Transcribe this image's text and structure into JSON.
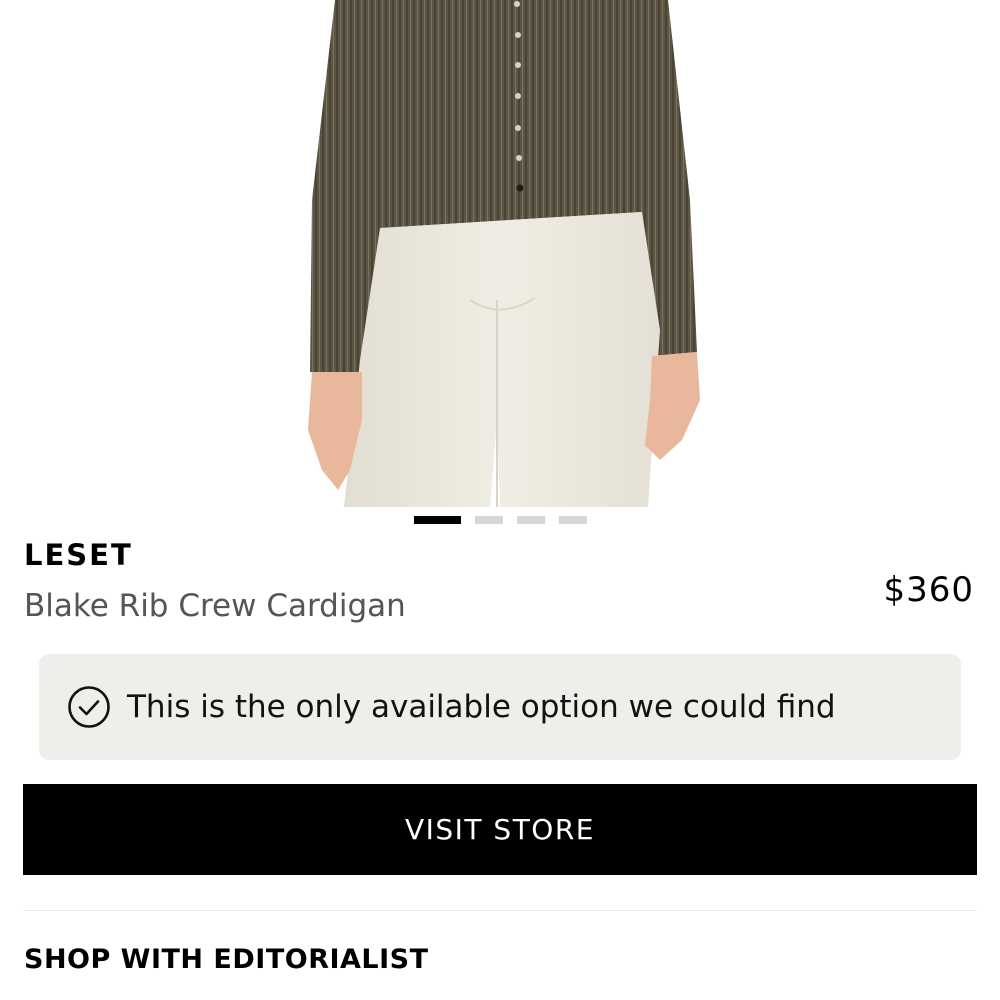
{
  "product": {
    "brand": "LESET",
    "name": "Blake Rib Crew Cardigan",
    "price": "$360",
    "image_description_icon": "product-photo"
  },
  "carousel": {
    "total": 4,
    "active_index": 0
  },
  "notice": {
    "icon": "check-circle-icon",
    "text": "This is the only available option we could find"
  },
  "actions": {
    "visit_store_label": "VISIT STORE"
  },
  "sections": {
    "shop_title": "SHOP WITH EDITORIALIST"
  },
  "colors": {
    "button_bg": "#000000",
    "notice_bg": "#efeeeb",
    "dot_active": "#000000",
    "dot_inactive": "#d6d6d6",
    "cardigan": "#5b5443",
    "pants": "#ece9df"
  }
}
